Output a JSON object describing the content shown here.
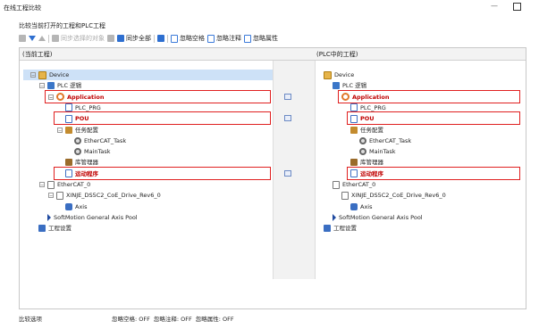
{
  "window": {
    "title": "在线工程比较"
  },
  "subtitle": "比较当前打开的工程和PLC工程",
  "toolbar": {
    "sync_selected": "同步选择的对象",
    "sync_all": "同步全部",
    "ignore_whitespace": "忽略空格",
    "ignore_comments": "忽略注释",
    "ignore_properties": "忽略属性"
  },
  "left_header": "(当前工程)",
  "right_header": "(PLC中的工程)",
  "tree": [
    {
      "label": "Device",
      "icon": "device-icon",
      "state": "normal"
    },
    {
      "label": "PLC 逻辑",
      "icon": "plc-logic-icon",
      "state": "normal"
    },
    {
      "label": "Application",
      "icon": "application-icon",
      "state": "changed"
    },
    {
      "label": "PLC_PRG",
      "icon": "pou-icon",
      "state": "normal"
    },
    {
      "label": "POU",
      "icon": "pou-icon",
      "state": "changed"
    },
    {
      "label": "任务配置",
      "icon": "task-config-icon",
      "state": "normal"
    },
    {
      "label": "EtherCAT_Task",
      "icon": "task-gear-icon",
      "state": "normal"
    },
    {
      "label": "MainTask",
      "icon": "task-gear-icon",
      "state": "normal"
    },
    {
      "label": "库管理器",
      "icon": "library-icon",
      "state": "normal"
    },
    {
      "label": "运动程序",
      "icon": "pou-icon",
      "state": "changed"
    },
    {
      "label": "EtherCAT_0",
      "icon": "ethercat-icon",
      "state": "normal"
    },
    {
      "label": "XINJE_DS5C2_CoE_Drive_Rev6_0",
      "icon": "ethercat-icon",
      "state": "normal"
    },
    {
      "label": "Axis",
      "icon": "axis-icon",
      "state": "normal"
    },
    {
      "label": "SoftMotion General Axis Pool",
      "icon": "softmotion-icon",
      "state": "normal"
    },
    {
      "label": "工程设置",
      "icon": "project-settings-icon",
      "state": "normal"
    }
  ],
  "status": {
    "compare_options": "比较选项",
    "ignore_whitespace": "忽略空格: OFF",
    "ignore_comments": "忽略注释: OFF",
    "ignore_properties": "忽略属性: OFF"
  },
  "colors": {
    "changed_text": "#c00000",
    "highlight_box": "#e02020",
    "selection": "#cde1f7"
  }
}
